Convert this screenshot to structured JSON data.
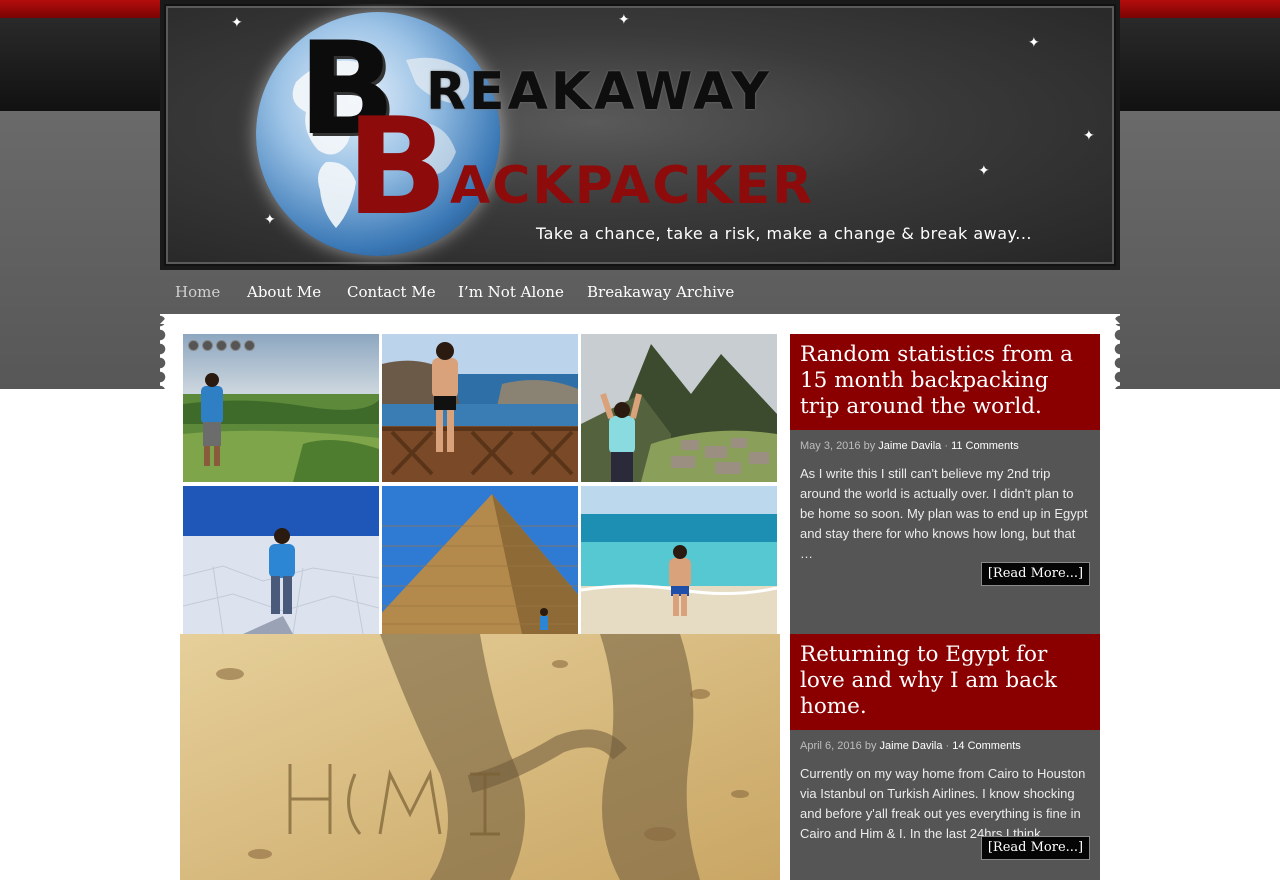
{
  "site": {
    "logo_word1": "REAKAWAY",
    "logo_word2": "ACKPACKER",
    "logo_letter": "B",
    "tagline": "Take a chance, take a risk, make a change & break away..."
  },
  "nav": {
    "items": [
      {
        "label": "Home",
        "active": true
      },
      {
        "label": "About Me"
      },
      {
        "label": "Contact Me"
      },
      {
        "label": "I’m Not Alone"
      },
      {
        "label": "Breakaway Archive"
      }
    ]
  },
  "slider": {
    "slide_count": 5,
    "photos": [
      "rice-terraces",
      "rocky-coast-balcony",
      "machu-picchu",
      "salt-flats",
      "great-pyramid",
      "turquoise-beach"
    ]
  },
  "posts": [
    {
      "title": "Random statistics from a 15 month backpacking trip around the world.",
      "date": "May 3, 2016",
      "by": "by",
      "author": "Jaime Davila",
      "sep": "·",
      "comments": "11 Comments",
      "excerpt": "As I write this I still can't believe my 2nd trip around the world is actually over. I didn't plan to be home so soon. My plan was to end up in Egypt and stay there for who knows how long, but that …",
      "read_more": "[Read More...]"
    },
    {
      "title": "Returning to Egypt for love and why I am back home.",
      "date": "April 6, 2016",
      "by": "by",
      "author": "Jaime Davila",
      "sep": "·",
      "comments": "14 Comments",
      "excerpt": "Currently on my way home from Cairo to Houston via Istanbul on Turkish Airlines. I know shocking and before y'all freak out yes everything is fine in Cairo and Him & I. In the last 24hrs I think …",
      "read_more": "[Read More...]"
    }
  ],
  "colors": {
    "brand_red": "#8a0000",
    "post_bg": "#555555",
    "nav_text": "#ffffff"
  }
}
